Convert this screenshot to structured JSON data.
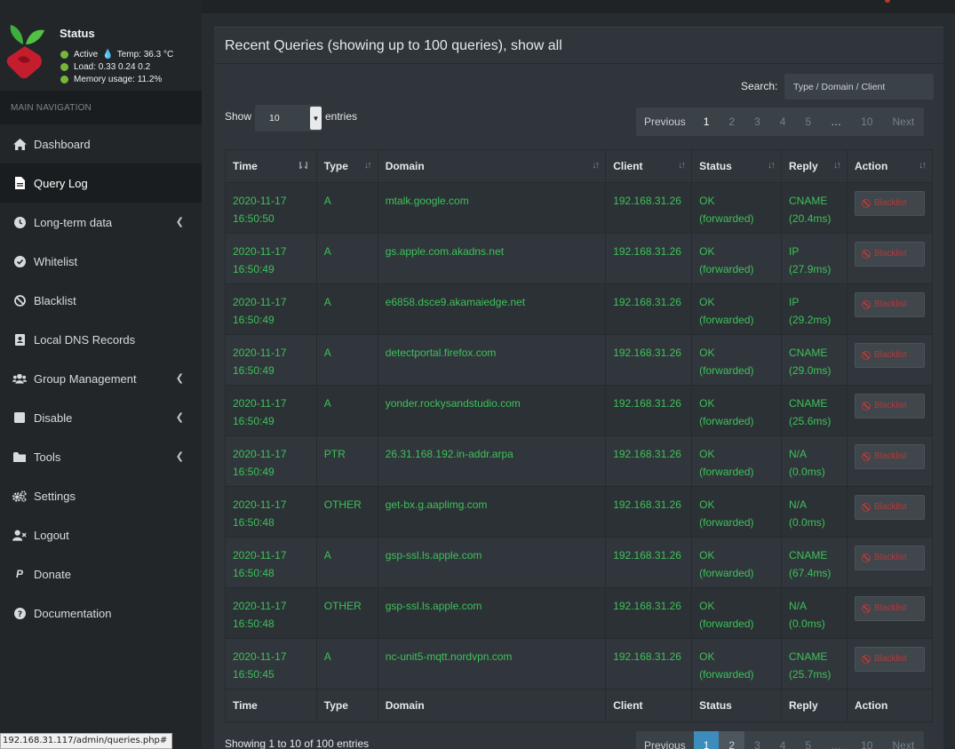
{
  "status": {
    "title": "Status",
    "active": "Active",
    "temp": "Temp: 36.3 °C",
    "load": "Load:  0.33  0.24  0.2",
    "memory": "Memory usage:  11.2%"
  },
  "nav": {
    "header": "MAIN NAVIGATION",
    "items": [
      {
        "label": "Dashboard"
      },
      {
        "label": "Query Log"
      },
      {
        "label": "Long-term data"
      },
      {
        "label": "Whitelist"
      },
      {
        "label": "Blacklist"
      },
      {
        "label": "Local DNS Records"
      },
      {
        "label": "Group Management"
      },
      {
        "label": "Disable"
      },
      {
        "label": "Tools"
      },
      {
        "label": "Settings"
      },
      {
        "label": "Logout"
      },
      {
        "label": "Donate"
      },
      {
        "label": "Documentation"
      }
    ]
  },
  "status_url": "192.168.31.117/admin/queries.php#",
  "box": {
    "title": "Recent Queries (showing up to 100 queries), show all"
  },
  "search": {
    "label": "Search:",
    "placeholder": "Type / Domain / Client"
  },
  "length": {
    "show": "Show",
    "value": "10",
    "entries": "entries"
  },
  "pager": {
    "prev": "Previous",
    "p1": "1",
    "p2": "2",
    "p3": "3",
    "p4": "4",
    "p5": "5",
    "ellipsis": "…",
    "p10": "10",
    "next": "Next"
  },
  "table": {
    "headers": {
      "time": "Time",
      "type": "Type",
      "domain": "Domain",
      "client": "Client",
      "status": "Status",
      "reply": "Reply",
      "action": "Action"
    },
    "action_label": "Blacklist",
    "rows": [
      {
        "date": "2020-11-17",
        "time": "16:50:50",
        "type": "A",
        "domain": "mtalk.google.com",
        "client": "192.168.31.26",
        "status": "OK",
        "status2": "(forwarded)",
        "reply": "CNAME",
        "reply2": "(20.4ms)"
      },
      {
        "date": "2020-11-17",
        "time": "16:50:49",
        "type": "A",
        "domain": "gs.apple.com.akadns.net",
        "client": "192.168.31.26",
        "status": "OK",
        "status2": "(forwarded)",
        "reply": "IP",
        "reply2": "(27.9ms)"
      },
      {
        "date": "2020-11-17",
        "time": "16:50:49",
        "type": "A",
        "domain": "e6858.dsce9.akamaiedge.net",
        "client": "192.168.31.26",
        "status": "OK",
        "status2": "(forwarded)",
        "reply": "IP",
        "reply2": "(29.2ms)"
      },
      {
        "date": "2020-11-17",
        "time": "16:50:49",
        "type": "A",
        "domain": "detectportal.firefox.com",
        "client": "192.168.31.26",
        "status": "OK",
        "status2": "(forwarded)",
        "reply": "CNAME",
        "reply2": "(29.0ms)"
      },
      {
        "date": "2020-11-17",
        "time": "16:50:49",
        "type": "A",
        "domain": "yonder.rockysandstudio.com",
        "client": "192.168.31.26",
        "status": "OK",
        "status2": "(forwarded)",
        "reply": "CNAME",
        "reply2": "(25.6ms)"
      },
      {
        "date": "2020-11-17",
        "time": "16:50:49",
        "type": "PTR",
        "domain": "26.31.168.192.in-addr.arpa",
        "client": "192.168.31.26",
        "status": "OK",
        "status2": "(forwarded)",
        "reply": "N/A",
        "reply2": "(0.0ms)"
      },
      {
        "date": "2020-11-17",
        "time": "16:50:48",
        "type": "OTHER",
        "domain": "get-bx.g.aaplimg.com",
        "client": "192.168.31.26",
        "status": "OK",
        "status2": "(forwarded)",
        "reply": "N/A",
        "reply2": "(0.0ms)"
      },
      {
        "date": "2020-11-17",
        "time": "16:50:48",
        "type": "A",
        "domain": "gsp-ssl.ls.apple.com",
        "client": "192.168.31.26",
        "status": "OK",
        "status2": "(forwarded)",
        "reply": "CNAME",
        "reply2": "(67.4ms)"
      },
      {
        "date": "2020-11-17",
        "time": "16:50:48",
        "type": "OTHER",
        "domain": "gsp-ssl.ls.apple.com",
        "client": "192.168.31.26",
        "status": "OK",
        "status2": "(forwarded)",
        "reply": "N/A",
        "reply2": "(0.0ms)"
      },
      {
        "date": "2020-11-17",
        "time": "16:50:45",
        "type": "A",
        "domain": "nc-unit5-mqtt.nordvpn.com",
        "client": "192.168.31.26",
        "status": "OK",
        "status2": "(forwarded)",
        "reply": "CNAME",
        "reply2": "(25.7ms)"
      }
    ]
  },
  "info": "Showing 1 to 10 of 100 entries",
  "colors": {
    "ok_green": "#3ec15a",
    "sidebar": "#222629",
    "content_box": "#2f353a",
    "accent_blue": "#3c8dbc",
    "danger_red": "#b23a3a"
  }
}
